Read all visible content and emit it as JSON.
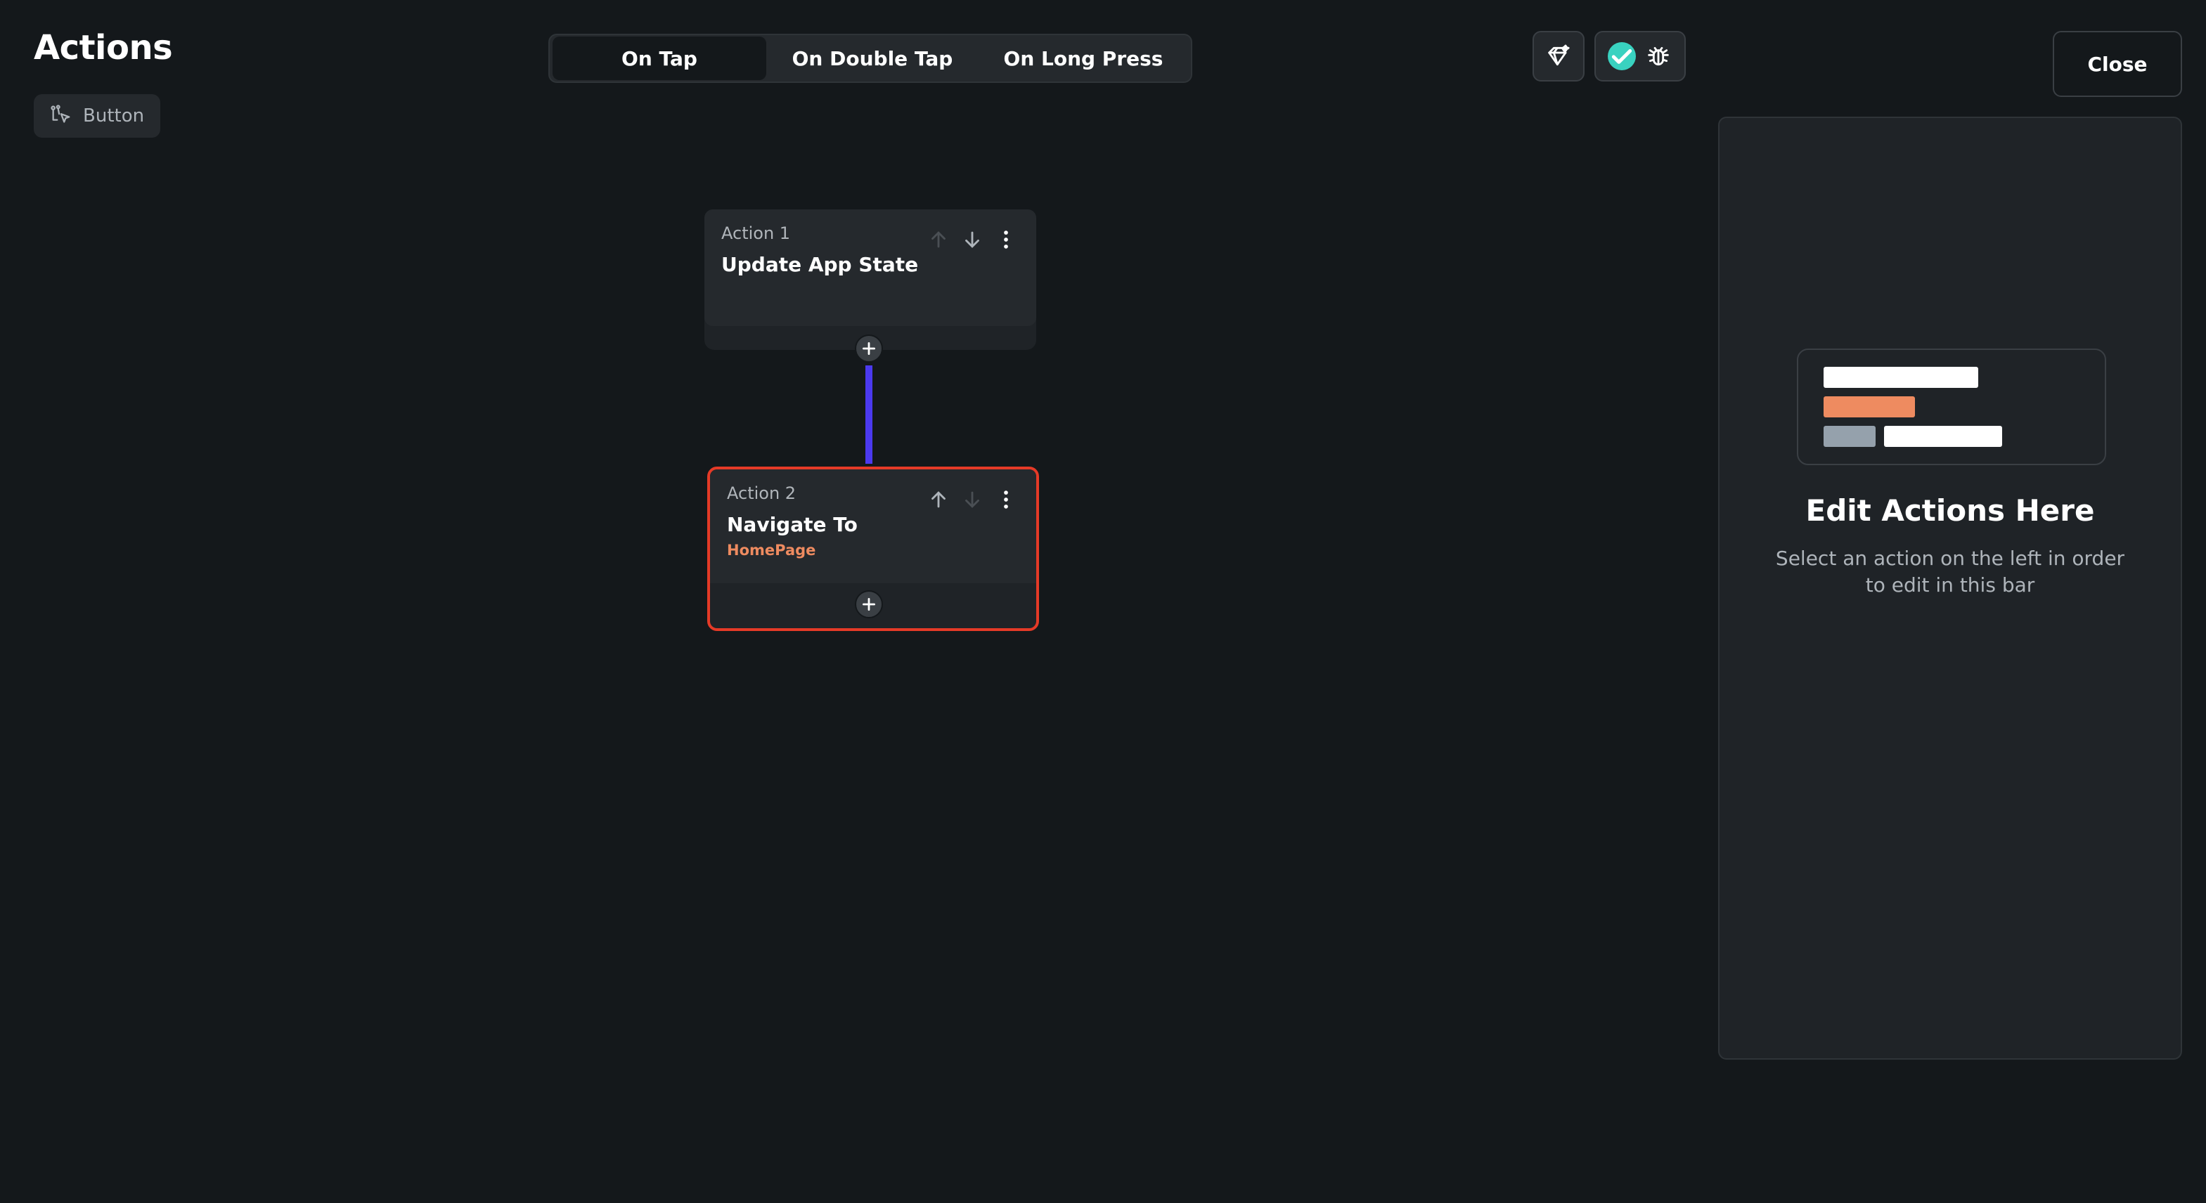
{
  "header": {
    "title": "Actions",
    "widget_chip": {
      "label": "Button",
      "icon": "widget-tree-icon"
    }
  },
  "tabs": [
    {
      "label": "On Tap",
      "active": true
    },
    {
      "label": "On Double Tap",
      "active": false
    },
    {
      "label": "On Long Press",
      "active": false
    }
  ],
  "toolbar": {
    "ai_icon": "ai-sparkle-icon",
    "valid_icon": "check-circle-icon",
    "debug_icon": "bug-icon",
    "close_label": "Close"
  },
  "flow": {
    "actions": [
      {
        "label": "Action 1",
        "name": "Update App State",
        "subtitle": "",
        "selected": false
      },
      {
        "label": "Action 2",
        "name": "Navigate To",
        "subtitle": "HomePage",
        "selected": true
      }
    ]
  },
  "panel": {
    "title": "Edit Actions Here",
    "description": "Select an action on the left in order to edit in this bar"
  },
  "colors": {
    "background": "#14181b",
    "surface": "#25292d",
    "accent_connector": "#4b39ef",
    "selected_border": "#e53a27",
    "subtitle": "#ee8b60",
    "success": "#39d2c0"
  }
}
